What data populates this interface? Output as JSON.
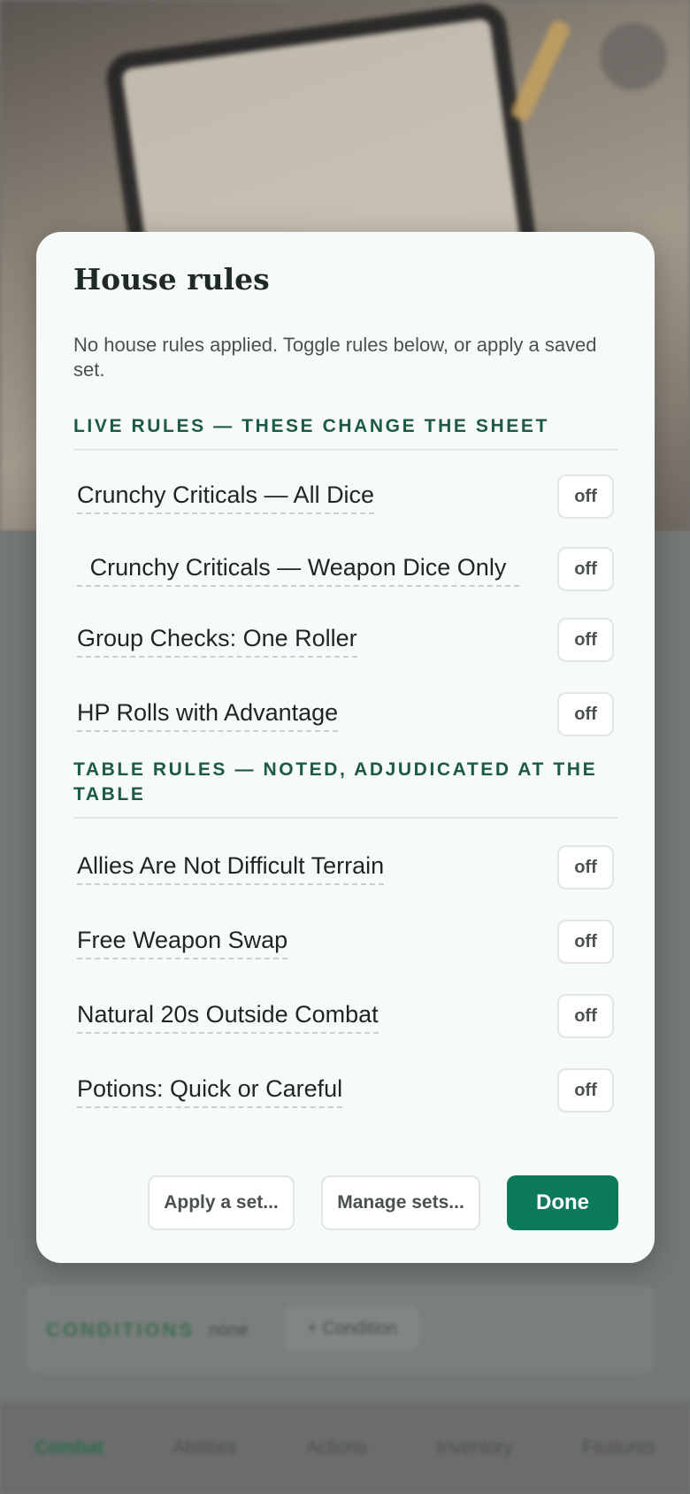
{
  "background": {
    "conditions_label": "CONDITIONS",
    "conditions_value": "none",
    "add_condition_label": "+ Condition",
    "tabs": [
      "Combat",
      "Abilities",
      "Actions",
      "Inventory",
      "Features"
    ]
  },
  "modal": {
    "title": "House rules",
    "subtitle": "No house rules applied. Toggle rules below, or apply a saved set.",
    "live_section_title": "LIVE RULES — THESE CHANGE THE SHEET",
    "live_rules": [
      {
        "label": "Crunchy Criticals — All Dice",
        "state": "off"
      },
      {
        "label": "Crunchy Criticals — Weapon Dice Only",
        "state": "off"
      },
      {
        "label": "Group Checks: One Roller",
        "state": "off"
      },
      {
        "label": "HP Rolls with Advantage",
        "state": "off"
      }
    ],
    "table_section_title": "TABLE RULES — NOTED, ADJUDICATED AT THE TABLE",
    "table_rules": [
      {
        "label": "Allies Are Not Difficult Terrain",
        "state": "off"
      },
      {
        "label": "Free Weapon Swap",
        "state": "off"
      },
      {
        "label": "Natural 20s Outside Combat",
        "state": "off"
      },
      {
        "label": "Potions: Quick or Careful",
        "state": "off"
      }
    ],
    "buttons": {
      "apply_set": "Apply a set...",
      "manage_sets": "Manage sets...",
      "done": "Done"
    }
  },
  "colors": {
    "accent": "#0d7a5c",
    "section_heading": "#1c5b42",
    "modal_bg": "#f6faf8"
  }
}
